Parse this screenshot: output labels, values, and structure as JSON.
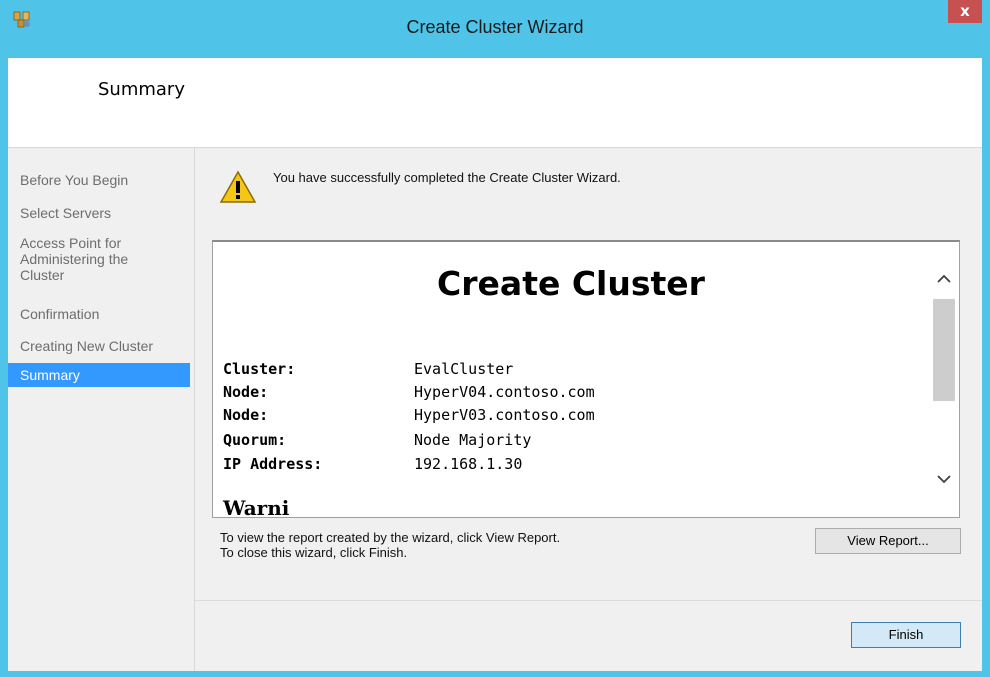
{
  "window": {
    "title": "Create Cluster Wizard",
    "close_glyph": "x"
  },
  "header": {
    "title": "Summary"
  },
  "nav": {
    "items": [
      {
        "label": "Before You Begin"
      },
      {
        "label": "Select Servers"
      },
      {
        "label": "Access Point for Administering the Cluster"
      },
      {
        "label": "Confirmation"
      },
      {
        "label": "Creating New Cluster"
      },
      {
        "label": "Summary",
        "selected": true
      }
    ]
  },
  "main": {
    "success_message": "You have successfully completed the Create Cluster Wizard.",
    "report": {
      "title": "Create Cluster",
      "rows": [
        {
          "key": "Cluster:",
          "value": "EvalCluster"
        },
        {
          "key": "Node:",
          "value": "HyperV04.contoso.com"
        },
        {
          "key": "Node:",
          "value": "HyperV03.contoso.com"
        },
        {
          "key": "Quorum:",
          "value": "Node Majority"
        },
        {
          "key": "IP Address:",
          "value": "192.168.1.30"
        }
      ],
      "next_section_partial": "Warni"
    },
    "info_line1": "To view the report created by the wizard, click View Report.",
    "info_line2": "To close this wizard, click Finish.",
    "view_report_label": "View Report...",
    "finish_label": "Finish"
  },
  "colors": {
    "titlebar": "#4fc3e8",
    "close": "#c75050",
    "selection": "#3399ff",
    "warning": "#f5c518"
  },
  "icons": {
    "app": "cluster-app-icon",
    "warning": "warning-icon",
    "scroll_up": "chevron-up-icon",
    "scroll_down": "chevron-down-icon"
  }
}
